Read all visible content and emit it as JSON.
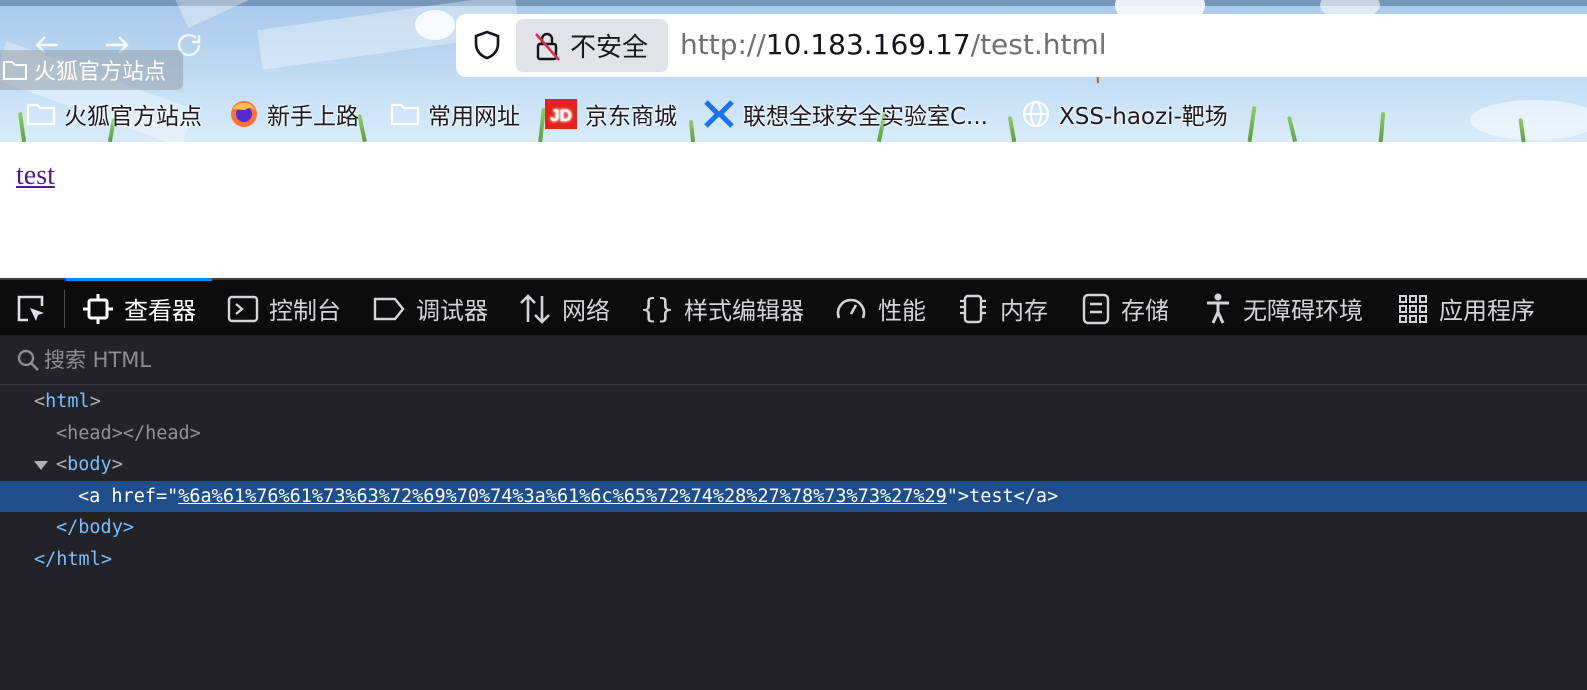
{
  "browser": {
    "tooltip": "火狐官方站点",
    "url_bar": {
      "security_label": "不安全",
      "url_prefix": "http://",
      "url_host": "10.183.169.17",
      "url_path": "/test.html"
    },
    "bookmarks": [
      {
        "label": "火狐官方站点",
        "icon": "folder-icon"
      },
      {
        "label": "新手上路",
        "icon": "firefox-icon"
      },
      {
        "label": "常用网址",
        "icon": "folder-icon"
      },
      {
        "label": "京东商城",
        "icon": "jd-icon"
      },
      {
        "label": "联想全球安全实验室C...",
        "icon": "lenovo-icon"
      },
      {
        "label": "XSS-haozi-靶场",
        "icon": "globe-icon"
      }
    ]
  },
  "page": {
    "link_text": "test"
  },
  "devtools": {
    "tabs": [
      {
        "label": "查看器",
        "icon": "inspector-icon",
        "active": true
      },
      {
        "label": "控制台",
        "icon": "console-icon"
      },
      {
        "label": "调试器",
        "icon": "debugger-icon"
      },
      {
        "label": "网络",
        "icon": "network-icon"
      },
      {
        "label": "样式编辑器",
        "icon": "style-editor-icon"
      },
      {
        "label": "性能",
        "icon": "performance-icon"
      },
      {
        "label": "内存",
        "icon": "memory-icon"
      },
      {
        "label": "存储",
        "icon": "storage-icon"
      },
      {
        "label": "无障碍环境",
        "icon": "accessibility-icon"
      },
      {
        "label": "应用程序",
        "icon": "application-icon"
      }
    ],
    "search_placeholder": "搜索 HTML",
    "markup": {
      "html_open": "html",
      "head": "<head></head>",
      "body_open": "body",
      "a_tag": "a",
      "a_attr": "href",
      "a_value": "%6a%61%76%61%73%63%72%69%70%74%3a%61%6c%65%72%74%28%27%78%73%73%27%29",
      "a_text": "test",
      "body_close": "</body>",
      "html_close": "</html>"
    },
    "colors": {
      "toolbar_bg": "#0c0c0d",
      "panel_bg": "#232327",
      "selection": "#204e8a",
      "tag": "#75bfff",
      "active_tab": "#0a84ff"
    }
  }
}
